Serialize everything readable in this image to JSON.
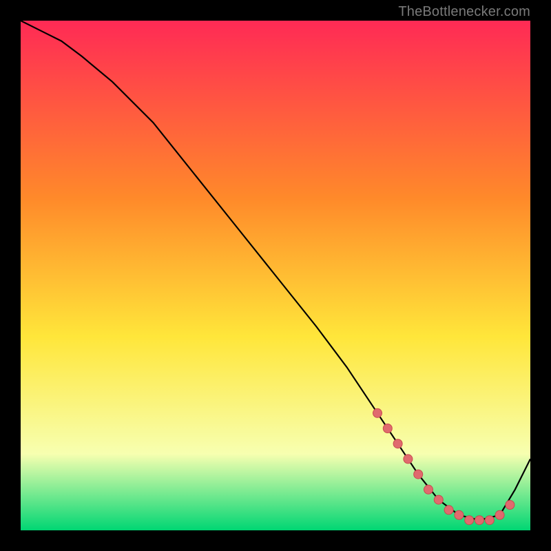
{
  "attribution": "TheBottlenecker.com",
  "colors": {
    "gradient_top": "#ff2a55",
    "gradient_mid1": "#ff8a2a",
    "gradient_mid2": "#ffe63a",
    "gradient_mid3": "#f7ffb0",
    "gradient_bottom": "#00d673",
    "curve": "#000000",
    "dot_fill": "#e06a6e",
    "dot_stroke": "#c94a4e",
    "background": "#000000"
  },
  "chart_data": {
    "type": "line",
    "title": "",
    "xlabel": "",
    "ylabel": "",
    "xlim": [
      0,
      100
    ],
    "ylim": [
      0,
      100
    ],
    "grid": false,
    "legend": false,
    "series": [
      {
        "name": "bottleneck-curve",
        "x": [
          0,
          4,
          8,
          12,
          18,
          26,
          34,
          42,
          50,
          58,
          64,
          70,
          74,
          78,
          82,
          86,
          90,
          94,
          97,
          100
        ],
        "y": [
          100,
          98,
          96,
          93,
          88,
          80,
          70,
          60,
          50,
          40,
          32,
          23,
          17,
          11,
          6,
          3,
          2,
          3,
          8,
          14
        ]
      }
    ],
    "emphasis_points": {
      "name": "optimal-range-dots",
      "x": [
        70,
        72,
        74,
        76,
        78,
        80,
        82,
        84,
        86,
        88,
        90,
        92,
        94,
        96
      ],
      "y": [
        23,
        20,
        17,
        14,
        11,
        8,
        6,
        4,
        3,
        2,
        2,
        2,
        3,
        5
      ]
    }
  }
}
